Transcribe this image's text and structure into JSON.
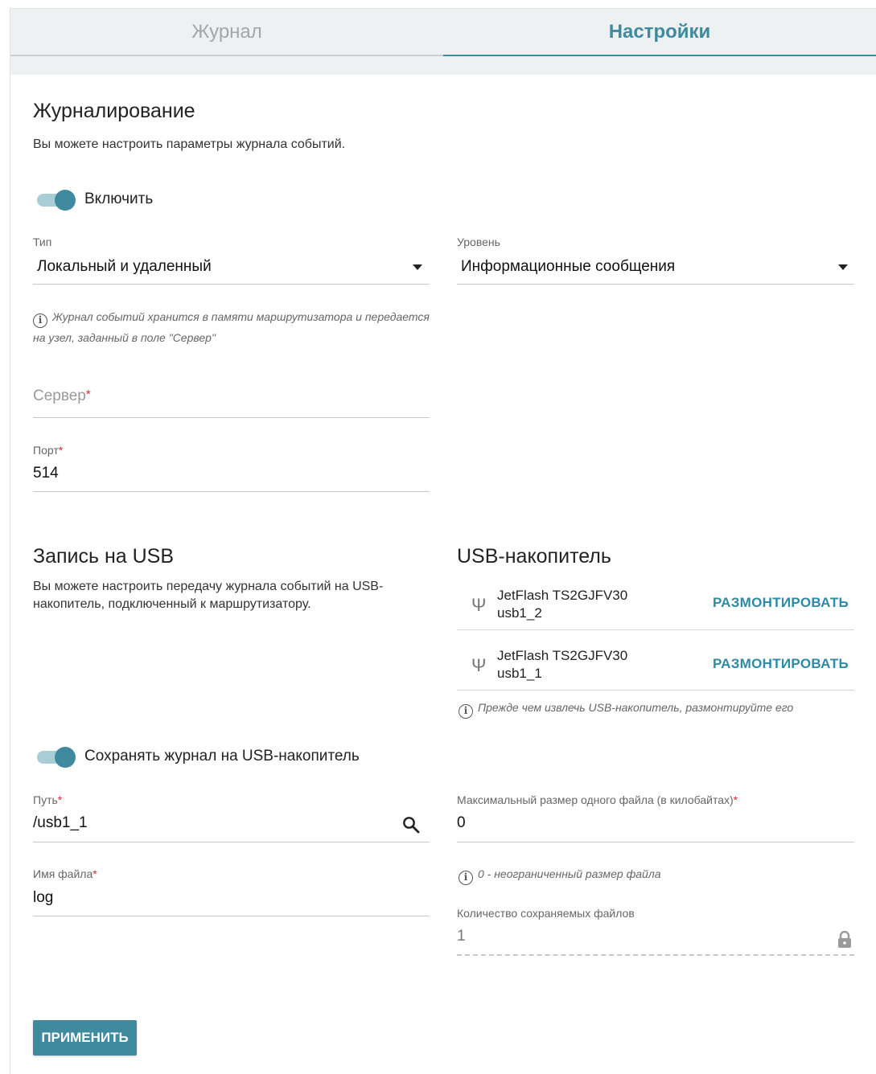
{
  "tabs": [
    {
      "label": "Журнал",
      "active": false
    },
    {
      "label": "Настройки",
      "active": true
    }
  ],
  "logging": {
    "title": "Журналирование",
    "description": "Вы можете настроить параметры журнала событий.",
    "enable_label": "Включить",
    "enabled": true,
    "type_label": "Тип",
    "type_value": "Локальный и удаленный",
    "level_label": "Уровень",
    "level_value": "Информационные сообщения",
    "note_line1": "Журнал событий хранится в памяти маршрутизатора и передается",
    "note_line2": "на узел, заданный в поле \"Сервер\"",
    "server_placeholder": "Сервер",
    "port_label": "Порт",
    "port_value": "514",
    "required_mark": "*"
  },
  "usb_write": {
    "title": "Запись на USB",
    "description_line1": "Вы можете настроить передачу журнала событий на USB-",
    "description_line2": "накопитель, подключенный к маршрутизатору.",
    "save_label": "Сохранять журнал на USB-накопитель",
    "save_enabled": true,
    "path_label": "Путь",
    "path_value": "/usb1_1",
    "filename_label": "Имя файла",
    "filename_value": "log",
    "max_size_label": "Максимальный размер одного файла (в килобайтах)",
    "max_size_value": "0",
    "max_size_note": "0 - неограниченный размер файла",
    "file_count_label": "Количество сохраняемых файлов",
    "file_count_value": "1"
  },
  "usb_storage": {
    "title": "USB-накопитель",
    "devices": [
      {
        "name": "JetFlash TS2GJFV30",
        "id": "usb1_2",
        "action": "РАЗМОНТИРОВАТЬ"
      },
      {
        "name": "JetFlash TS2GJFV30",
        "id": "usb1_1",
        "action": "РАЗМОНТИРОВАТЬ"
      }
    ],
    "note": "Прежде чем извлечь USB-накопитель, размонтируйте его"
  },
  "apply_label": "ПРИМЕНИТЬ",
  "icons": {
    "info": "i",
    "usb": "Ψ",
    "search": "search-icon",
    "lock": "lock-icon"
  },
  "colors": {
    "accent": "#3f8a9e",
    "link": "#2f8aa6",
    "required": "#d03030"
  }
}
